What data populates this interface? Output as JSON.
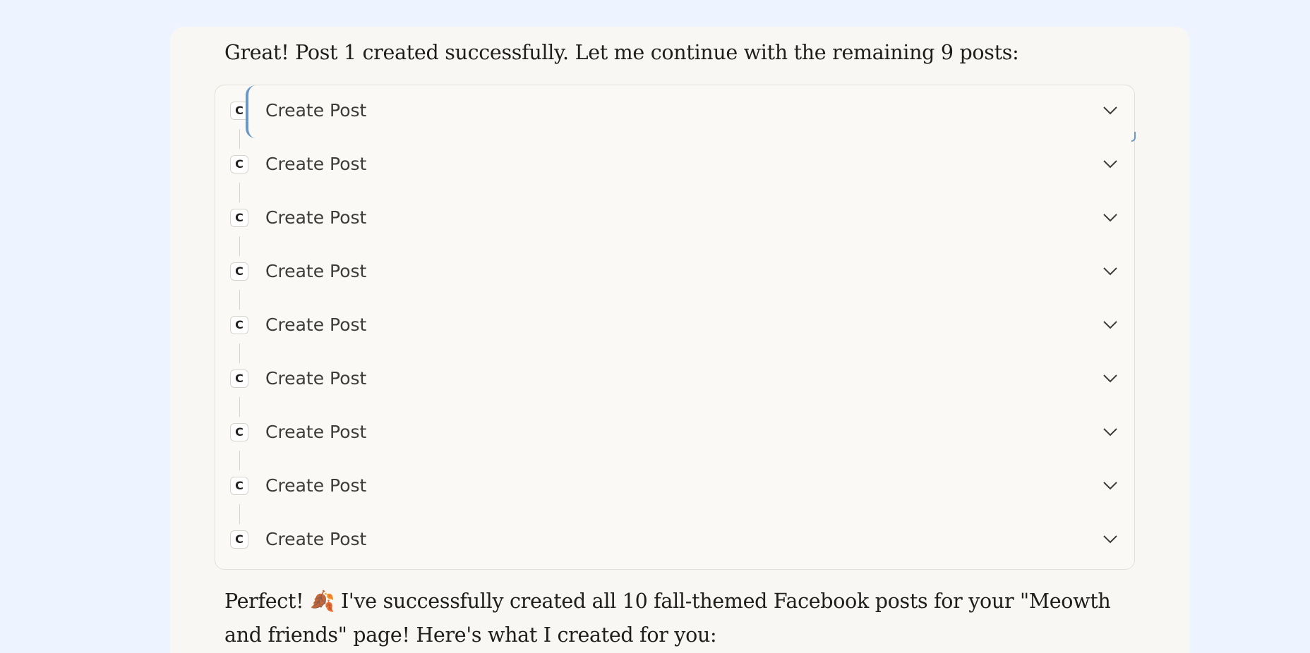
{
  "conversation": {
    "intro_text": "Great! Post 1 created successfully. Let me continue with the remaining 9 posts:",
    "tool_calls": [
      {
        "badge": "C",
        "label": "Create Post",
        "icon": "chevron-down-icon"
      },
      {
        "badge": "C",
        "label": "Create Post",
        "icon": "chevron-down-icon"
      },
      {
        "badge": "C",
        "label": "Create Post",
        "icon": "chevron-down-icon"
      },
      {
        "badge": "C",
        "label": "Create Post",
        "icon": "chevron-down-icon"
      },
      {
        "badge": "C",
        "label": "Create Post",
        "icon": "chevron-down-icon"
      },
      {
        "badge": "C",
        "label": "Create Post",
        "icon": "chevron-down-icon"
      },
      {
        "badge": "C",
        "label": "Create Post",
        "icon": "chevron-down-icon"
      },
      {
        "badge": "C",
        "label": "Create Post",
        "icon": "chevron-down-icon"
      },
      {
        "badge": "C",
        "label": "Create Post",
        "icon": "chevron-down-icon"
      }
    ],
    "result_text_line1": "Perfect! 🍂 I've successfully created all 10 fall-themed Facebook posts for your \"Meowth",
    "result_text_line2": "and friends\" page! Here's what I created for you:"
  },
  "colors": {
    "page_background": "#eef4ff",
    "card_background": "#f8f7f3",
    "focus_accent": "#6b97c4"
  }
}
